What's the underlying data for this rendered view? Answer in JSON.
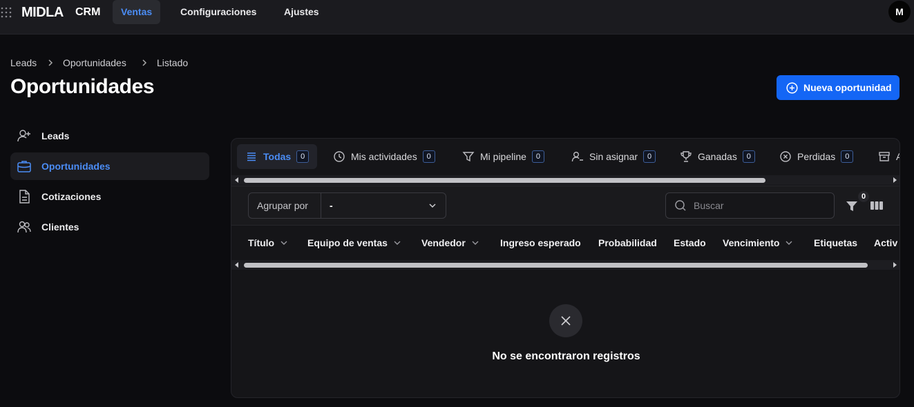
{
  "header": {
    "brand": "MIDLA",
    "brand_sub": "CRM",
    "nav": [
      "Ventas",
      "Configuraciones",
      "Ajustes"
    ],
    "avatar_initial": "M"
  },
  "breadcrumb": [
    "Leads",
    "Oportunidades",
    "Listado"
  ],
  "page_title": "Oportunidades",
  "new_button_label": "Nueva oportunidad",
  "sidebar": {
    "items": [
      {
        "label": "Leads",
        "icon": "user-plus-icon"
      },
      {
        "label": "Oportunidades",
        "icon": "briefcase-icon"
      },
      {
        "label": "Cotizaciones",
        "icon": "document-icon"
      },
      {
        "label": "Clientes",
        "icon": "users-icon"
      }
    ]
  },
  "tabs": [
    {
      "label": "Todas",
      "count": "0",
      "icon": "list-icon"
    },
    {
      "label": "Mis actividades",
      "count": "0",
      "icon": "clock-icon"
    },
    {
      "label": "Mi pipeline",
      "count": "0",
      "icon": "filter-icon"
    },
    {
      "label": "Sin asignar",
      "count": "0",
      "icon": "user-minus-icon"
    },
    {
      "label": "Ganadas",
      "count": "0",
      "icon": "trophy-icon"
    },
    {
      "label": "Perdidas",
      "count": "0",
      "icon": "x-circle-icon"
    },
    {
      "label": "A",
      "icon": "archive-icon"
    }
  ],
  "toolbar": {
    "group_by_label": "Agrupar por",
    "group_by_value": "-",
    "search_placeholder": "Buscar",
    "filter_count": "0"
  },
  "table": {
    "columns": [
      "Título",
      "Equipo de ventas",
      "Vendedor",
      "Ingreso esperado",
      "Probabilidad",
      "Estado",
      "Vencimiento",
      "Etiquetas",
      "Activ"
    ]
  },
  "empty_message": "No se encontraron registros",
  "colors": {
    "accent": "#4b8df6",
    "primary_button": "#1466f5",
    "background": "#0c0c0f"
  }
}
